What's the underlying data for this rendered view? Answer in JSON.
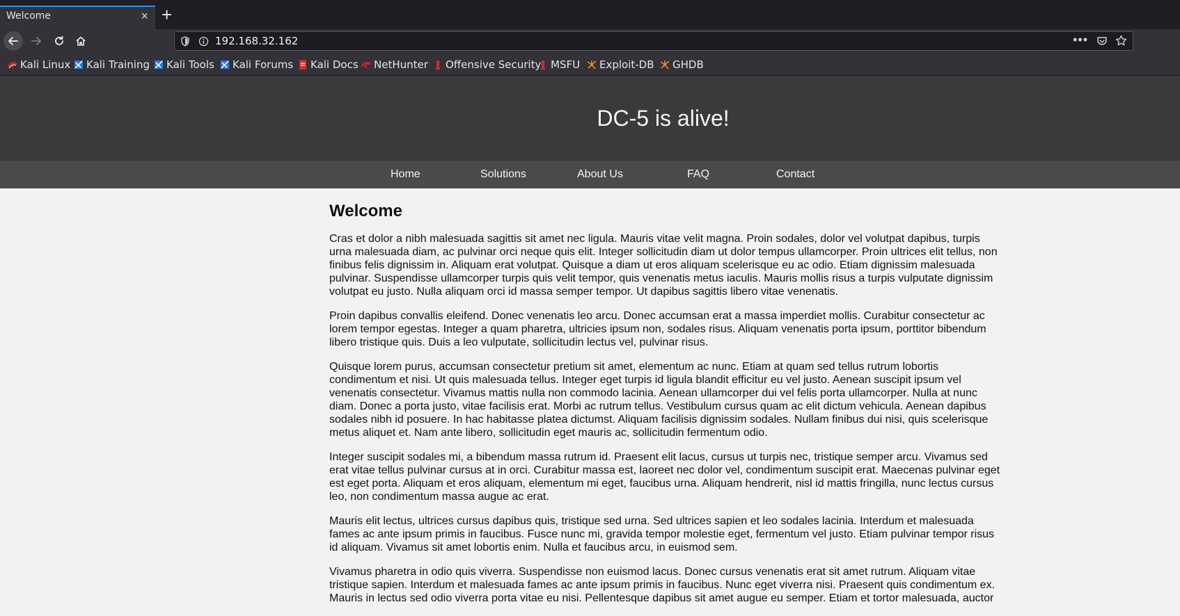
{
  "browser": {
    "tab_title": "Welcome",
    "tab_close": "×",
    "new_tab": "+",
    "url": "192.168.32.162",
    "more_menu": "•••",
    "accent_color": "#3a8ee6",
    "bookmarks": [
      {
        "label": "Kali Linux",
        "icon": "kali-dragon-icon"
      },
      {
        "label": "Kali Training",
        "icon": "kali-training-icon"
      },
      {
        "label": "Kali Tools",
        "icon": "kali-tools-icon"
      },
      {
        "label": "Kali Forums",
        "icon": "kali-forums-icon"
      },
      {
        "label": "Kali Docs",
        "icon": "kali-docs-icon"
      },
      {
        "label": "NetHunter",
        "icon": "nethunter-icon"
      },
      {
        "label": "Offensive Security",
        "icon": "offsec-icon"
      },
      {
        "label": "MSFU",
        "icon": "msfu-icon"
      },
      {
        "label": "Exploit-DB",
        "icon": "exploitdb-icon"
      },
      {
        "label": "GHDB",
        "icon": "ghdb-icon"
      }
    ]
  },
  "site": {
    "title": "DC-5 is alive!",
    "nav": [
      "Home",
      "Solutions",
      "About Us",
      "FAQ",
      "Contact"
    ],
    "heading": "Welcome",
    "paragraphs": [
      "Cras et dolor a nibh malesuada sagittis sit amet nec ligula. Mauris vitae velit magna. Proin sodales, dolor vel volutpat dapibus, turpis urna malesuada diam, ac pulvinar orci neque quis elit. Integer sollicitudin diam ut dolor tempus ullamcorper. Proin ultrices elit tellus, non finibus felis dignissim in. Aliquam erat volutpat. Quisque a diam ut eros aliquam scelerisque eu ac odio. Etiam dignissim malesuada pulvinar. Suspendisse ullamcorper turpis quis velit tempor, quis venenatis metus iaculis. Mauris mollis risus a turpis vulputate dignissim volutpat eu justo. Nulla aliquam orci id massa semper tempor. Ut dapibus sagittis libero vitae venenatis.",
      "Proin dapibus convallis eleifend. Donec venenatis leo arcu. Donec accumsan erat a massa imperdiet mollis. Curabitur consectetur ac lorem tempor egestas. Integer a quam pharetra, ultricies ipsum non, sodales risus. Aliquam venenatis porta ipsum, porttitor bibendum libero tristique quis. Duis a leo vulputate, sollicitudin lectus vel, pulvinar risus.",
      "Quisque lorem purus, accumsan consectetur pretium sit amet, elementum ac nunc. Etiam at quam sed tellus rutrum lobortis condimentum et nisi. Ut quis malesuada tellus. Integer eget turpis id ligula blandit efficitur eu vel justo. Aenean suscipit ipsum vel venenatis consectetur. Vivamus mattis nulla non commodo lacinia. Aenean ullamcorper dui vel felis porta ullamcorper. Nulla at nunc diam. Donec a porta justo, vitae facilisis erat. Morbi ac rutrum tellus. Vestibulum cursus quam ac elit dictum vehicula. Aenean dapibus sodales nibh id posuere. In hac habitasse platea dictumst. Aliquam facilisis dignissim sodales. Nullam finibus dui nisi, quis scelerisque metus aliquet et. Nam ante libero, sollicitudin eget mauris ac, sollicitudin fermentum odio.",
      "Integer suscipit sodales mi, a bibendum massa rutrum id. Praesent elit lacus, cursus ut turpis nec, tristique semper arcu. Vivamus sed erat vitae tellus pulvinar cursus at in orci. Curabitur massa est, laoreet nec dolor vel, condimentum suscipit erat. Maecenas pulvinar eget est eget porta. Aliquam et eros aliquam, elementum mi eget, faucibus urna. Aliquam hendrerit, nisl id mattis fringilla, nunc lectus cursus leo, non condimentum massa augue ac erat.",
      "Mauris elit lectus, ultrices cursus dapibus quis, tristique sed urna. Sed ultrices sapien et leo sodales lacinia. Interdum et malesuada fames ac ante ipsum primis in faucibus. Fusce nunc mi, gravida tempor molestie eget, fermentum vel justo. Etiam pulvinar tempor risus id aliquam. Vivamus sit amet lobortis enim. Nulla et faucibus arcu, in euismod sem.",
      "Vivamus pharetra in odio quis viverra. Suspendisse non euismod lacus. Donec cursus venenatis erat sit amet rutrum. Aliquam vitae tristique sapien. Interdum et malesuada fames ac ante ipsum primis in faucibus. Nunc eget viverra nisi. Praesent quis condimentum ex. Mauris in lectus sed odio viverra porta vitae eu nisi. Pellentesque dapibus sit amet augue eu semper. Etiam et tortor malesuada, auctor"
    ]
  }
}
